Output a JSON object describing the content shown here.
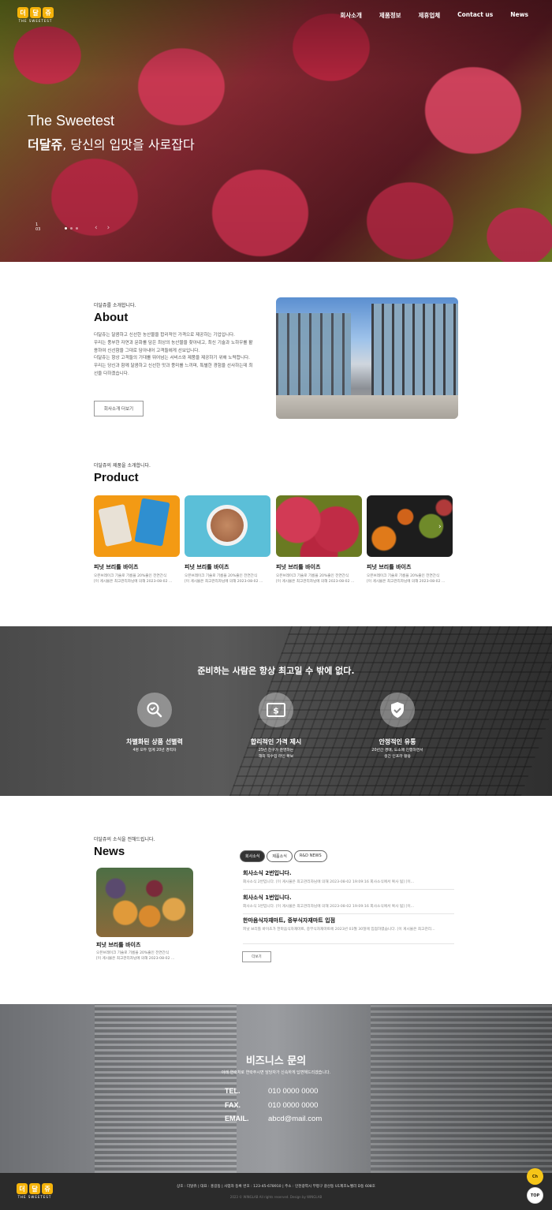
{
  "header": {
    "logo_chars": [
      "더",
      "달",
      "쥬"
    ],
    "logo_tag": "THE SWEETEST",
    "nav": [
      "회사소개",
      "제품정보",
      "제휴업체",
      "Contact us",
      "News"
    ]
  },
  "hero": {
    "line1": "The Sweetest",
    "line2_bold": "더달쥬",
    "line2_rest": ", 당신의 입맛을 사로잡다",
    "pager_top": "1",
    "pager_bottom": "03",
    "arrow_prev": "‹",
    "arrow_next": "›"
  },
  "about": {
    "kicker": "더달쥬를 소개합니다.",
    "title": "About",
    "paragraphs": [
      "더달쥬는 달콤하고 신선한 농산물을 합리적인 가격으로 제공하는 기업입니다.",
      "우리는 풍부한 자연과 문화를 담은 최상의 농산물을 찾아내고, 최신 기술과 노하우를 활용하여 신선함을 그대로 담아내어 고객들에게 선보입니다.",
      "더달쥬는 항상 고객들의 기대를 뛰어넘는 서비스와 제품을 제공하기 위해 노력합니다.",
      "우리는 당신과 함께 달콤하고 신선한 맛과 풍미를 느끼며, 특별한 경험을 선사하는데 최선을 다하겠습니다."
    ],
    "button": "회사소개 더보기"
  },
  "product": {
    "kicker": "더달쥬의 제품을 소개합니다.",
    "title": "Product",
    "items": [
      {
        "name": "피넛 브리틀 바이츠",
        "desc1": "오븐브레이크 기술로 기름을 20%줄인 전연간식",
        "desc2": "[이 게시물은 최고관리자님에 의해 2023-08-02 ..."
      },
      {
        "name": "피넛 브리틀 바이츠",
        "desc1": "오븐브레이크 기술로 기름을 20%줄인 전연간식",
        "desc2": "[이 게시물은 최고관리자님에 의해 2023-08-02 ..."
      },
      {
        "name": "피넛 브리틀 바이츠",
        "desc1": "오븐브레이크 기술로 기름을 20%줄인 전연간식",
        "desc2": "[이 게시물은 최고관리자님에 의해 2023-08-02 ..."
      },
      {
        "name": "피넛 브리틀 바이츠",
        "desc1": "오븐브레이크 기술로 기름을 20%줄인 전연간식",
        "desc2": "[이 게시물은 최고관리자님에 의해 2023-08-02 ..."
      }
    ],
    "next": "›"
  },
  "banner": {
    "title": "준비하는 사람은 항상 최고일 수 밖에 없다.",
    "features": [
      {
        "icon": "search-check-icon",
        "title": "차별화된 상품 선별력",
        "desc1": "4명 모두 업계 20년 경력자",
        "desc2": ""
      },
      {
        "icon": "dollar-icon",
        "title": "합리적인 가격 제시",
        "desc1": "25년 친구가 운영하는",
        "desc2": "해외 직수입 라인 확보"
      },
      {
        "icon": "shield-check-icon",
        "title": "안정적인 유통",
        "desc1": "20년간 경매, 도소매 진행하면서",
        "desc2": "생긴 인프라 활용"
      }
    ]
  },
  "news": {
    "kicker": "더달쥬의 소식을 전해드립니다.",
    "title": "News",
    "featured": {
      "name": "피넛 브리틀 바이츠",
      "desc1": "오븐브레이크 기술로 기름을 20%줄인 전연간식",
      "desc2": "[이 게시물은 최고관리자님에 의해 2023-08-02 ..."
    },
    "tabs": [
      "회사소식",
      "제품소식",
      "R&D NEWS"
    ],
    "items": [
      {
        "title": "회사소식 2번입니다.",
        "desc": "회사소식 2번입니다. [이 게시물은 최고관리자님에 의해 2023-08-02 19:09:16 회사소식에서 복사 됨] [이..."
      },
      {
        "title": "회사소식 1번입니다.",
        "desc": "회사소식 1번입니다. [이 게시물은 최고관리자님에 의해 2023-08-02 19:09:16 회사소식에서 복사 됨] [이..."
      },
      {
        "title": "한마음식자재마트, 중부식자재마트 입점",
        "desc": "피넛 브리틀 바이츠가 한마음식자재마트, 중부식자재마트에 2023년 03월 30일에 입점하였습니다. [이 게시물은 최고관리..."
      }
    ],
    "more": "더보기"
  },
  "business": {
    "title": "비즈니스 문의",
    "subtitle": "아래 연락처로 연락주시면 담당자가 신속하게 답변해드리겠습니다.",
    "contacts": [
      {
        "key": "TEL.",
        "value": "010 0000 0000"
      },
      {
        "key": "FAX.",
        "value": "010 0000 0000"
      },
      {
        "key": "EMAIL.",
        "value": "abcd@mail.com"
      }
    ]
  },
  "footer": {
    "info": "상호 : 더달쥬 | 대표 : 홍길동 | 사업자 등록 번호 : 123-45-678910 | 주소 : 인천광역시 부평구 갈산동 U1제조노벨리 D동 608호",
    "copyright": "2023 © WINGLAB All rights reserved. Design by WINGLAB",
    "chat_label": "Ch",
    "top_label": "TOP"
  },
  "colors": {
    "accent": "#f5b30a",
    "dark": "#2b2b2b"
  }
}
